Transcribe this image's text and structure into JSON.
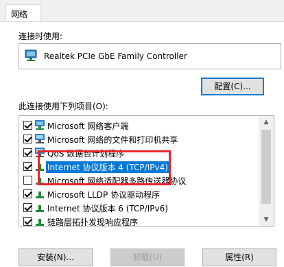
{
  "tabs": [
    {
      "label": "网络"
    }
  ],
  "connection_label": "连接时使用:",
  "adapter": {
    "name": "Realtek PCIe GbE Family Controller",
    "icon": "network-adapter-icon"
  },
  "configure_button": "配置(C)...",
  "items_label": "此连接使用下列项目(O):",
  "items": [
    {
      "label": "Microsoft 网络客户端",
      "checked": true,
      "icon": "network-client-icon"
    },
    {
      "label": "Microsoft 网络的文件和打印机共享",
      "checked": true,
      "icon": "network-service-icon"
    },
    {
      "label": "QoS 数据包计划程序",
      "checked": true,
      "icon": "network-service-icon"
    },
    {
      "label": "Internet 协议版本 4 (TCP/IPv4)",
      "checked": true,
      "icon": "protocol-icon",
      "selected": true
    },
    {
      "label": "Microsoft 网络适配器多路传送器协议",
      "checked": false,
      "icon": "protocol-icon"
    },
    {
      "label": "Microsoft LLDP 协议驱动程序",
      "checked": true,
      "icon": "protocol-icon"
    },
    {
      "label": "Internet 协议版本 6 (TCP/IPv6)",
      "checked": true,
      "icon": "protocol-icon"
    },
    {
      "label": "链路层拓扑发现响应程序",
      "checked": true,
      "icon": "protocol-icon"
    }
  ],
  "buttons": {
    "install": "安装(N)...",
    "uninstall": "卸载(U)",
    "properties": "属性(R)"
  },
  "colors": {
    "selection": "#0078d7",
    "highlight_box": "#e8262b",
    "button_bg": "#e1e1e1"
  }
}
